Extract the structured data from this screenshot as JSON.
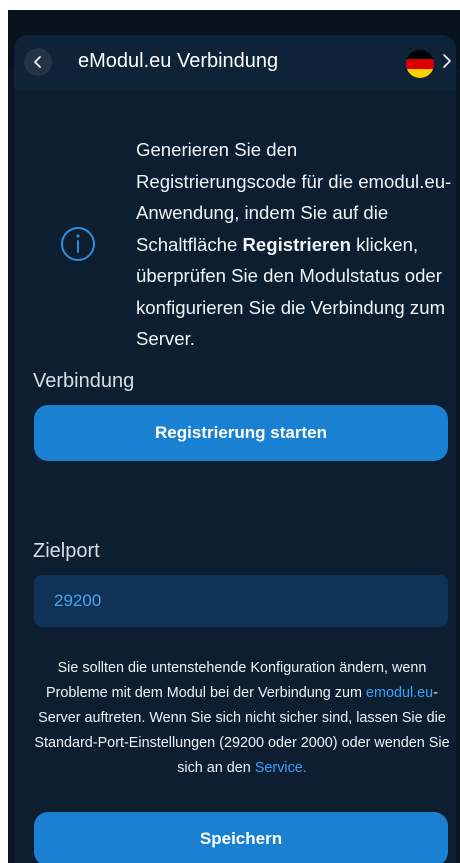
{
  "header": {
    "title": "eModul.eu Verbindung"
  },
  "info": {
    "text_before": "Generieren Sie den Registrierungscode für die emodul.eu-Anwendung, indem Sie auf die Schaltfläche ",
    "text_bold": "Registrieren",
    "text_after": " klicken, überprüfen Sie den Modulstatus oder konfigurieren Sie die Verbindung zum Server."
  },
  "connection": {
    "label": "Verbindung",
    "register_button": "Registrierung starten"
  },
  "target_port": {
    "label": "Zielport",
    "value": "29200"
  },
  "notice": {
    "part1": "Sie sollten die untenstehende Konfiguration ändern, wenn Probleme mit dem Modul bei der Verbindung zum ",
    "link1": "emodul.eu",
    "part2": "-Server auftreten. Wenn Sie sich nicht sicher sind, lassen Sie die Standard-Port-Einstellungen (29200 oder 2000) oder wenden Sie sich an den ",
    "link2": "Service."
  },
  "save_button": "Speichern",
  "colors": {
    "background": "#0a1622",
    "card": "#0d1e30",
    "accent": "#1a80d2",
    "link": "#3aa0ff"
  },
  "icons": {
    "back": "chevron-left-icon",
    "language": "german-flag-icon",
    "info": "info-circle-icon"
  }
}
